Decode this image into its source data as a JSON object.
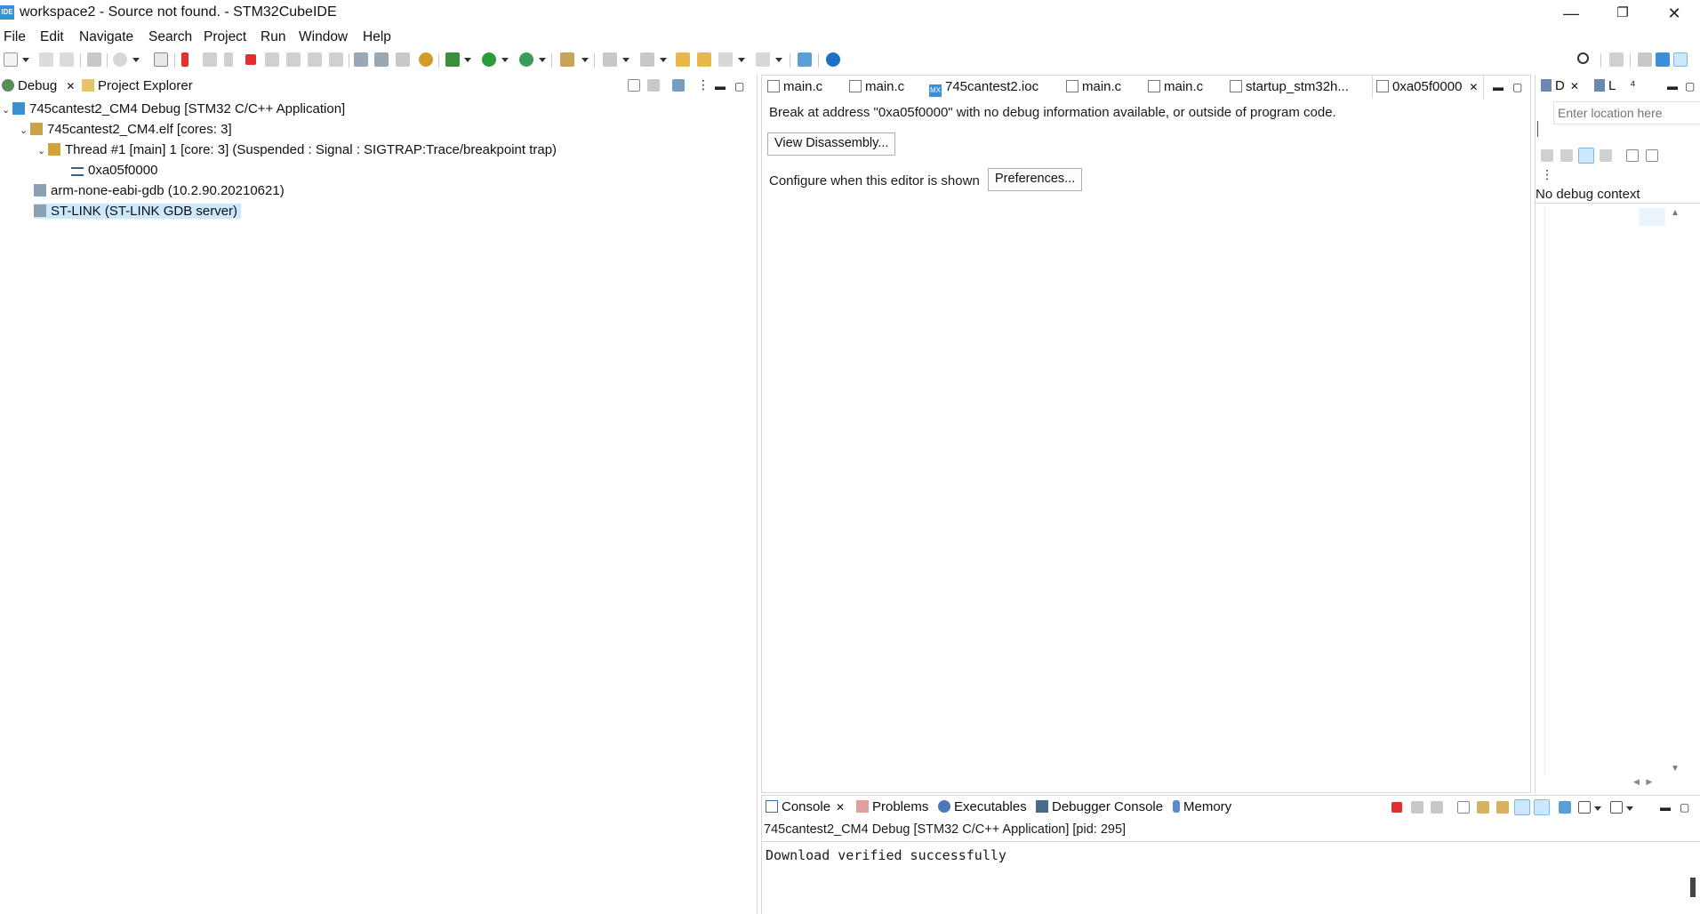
{
  "window": {
    "title": "workspace2 - Source not found. - STM32CubeIDE",
    "icon_text": "IDE",
    "minimize": "—",
    "restore": "❐",
    "close": "✕"
  },
  "menu": [
    "File",
    "Edit",
    "Navigate",
    "Search",
    "Project",
    "Run",
    "Window",
    "Help"
  ],
  "left_panel": {
    "tabs": [
      {
        "label": "Debug",
        "close": "✕"
      },
      {
        "label": "Project Explorer"
      }
    ],
    "tree": [
      {
        "label": "745cantest2_CM4 Debug [STM32 C/C++ Application]",
        "expand": "⌄"
      },
      {
        "label": "745cantest2_CM4.elf [cores: 3]",
        "expand": "⌄"
      },
      {
        "label": "Thread #1 [main] 1 [core: 3] (Suspended : Signal : SIGTRAP:Trace/breakpoint trap)",
        "expand": "⌄"
      },
      {
        "label": "0xa05f0000"
      },
      {
        "label": "arm-none-eabi-gdb (10.2.90.20210621)"
      },
      {
        "label": "ST-LINK (ST-LINK GDB server)"
      }
    ]
  },
  "editor": {
    "tabs": [
      {
        "label": "main.c"
      },
      {
        "label": "main.c"
      },
      {
        "label": "745cantest2.ioc",
        "badge": "MX"
      },
      {
        "label": "main.c"
      },
      {
        "label": "main.c"
      },
      {
        "label": "startup_stm32h..."
      },
      {
        "label": "0xa05f0000",
        "close": "✕"
      }
    ],
    "message": "Break at address \"0xa05f0000\" with no debug information available, or outside of program code.",
    "view_disassembly": "View Disassembly...",
    "configure_text": "Configure when this editor is shown",
    "preferences": "Preferences..."
  },
  "right_panel": {
    "tab1": "D",
    "tab2": "L",
    "tab3": "⁴",
    "close": "✕",
    "location_placeholder": "Enter location here",
    "no_context": "No debug context"
  },
  "console": {
    "tabs": [
      {
        "label": "Console",
        "close": "✕"
      },
      {
        "label": "Problems"
      },
      {
        "label": "Executables"
      },
      {
        "label": "Debugger Console"
      },
      {
        "label": "Memory"
      }
    ],
    "header": "745cantest2_CM4 Debug [STM32 C/C++ Application]  [pid: 295]",
    "output": "Download verified successfully"
  },
  "colors": {
    "selection": "#cce8ff",
    "accent_blue": "#3a8fd6",
    "terminate_red": "#e03030",
    "run_green": "#2a9d3a"
  }
}
